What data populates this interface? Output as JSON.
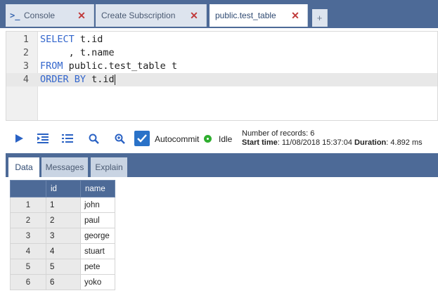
{
  "tabs": [
    {
      "label": "Console",
      "icon": "terminal-icon",
      "closable": true,
      "active": false
    },
    {
      "label": "Create Subscription",
      "closable": true,
      "active": false
    },
    {
      "label": "public.test_table",
      "closable": true,
      "active": true
    }
  ],
  "add_tab_label": "+",
  "editor": {
    "lines": [
      {
        "num": "1",
        "parts": [
          {
            "t": "SELECT",
            "kw": true
          },
          {
            "t": " t.id",
            "kw": false
          }
        ]
      },
      {
        "num": "2",
        "parts": [
          {
            "t": "     , t.name",
            "kw": false
          }
        ]
      },
      {
        "num": "3",
        "parts": [
          {
            "t": "FROM",
            "kw": true
          },
          {
            "t": " public.test_table t",
            "kw": false
          }
        ]
      },
      {
        "num": "4",
        "parts": [
          {
            "t": "ORDER BY",
            "kw": true
          },
          {
            "t": " t.id",
            "kw": false
          }
        ]
      }
    ],
    "current_line": 4
  },
  "toolbar": {
    "buttons": [
      "play-icon",
      "indent-icon",
      "list-icon",
      "search-icon",
      "zoom-in-icon"
    ],
    "autocommit_checked": true,
    "autocommit_label": "Autocommit",
    "status": "Idle",
    "status_color": "#2fae2f"
  },
  "records": {
    "count_line": "Number of records: 6",
    "start_label": "Start time",
    "start_value": ": 11/08/2018 15:37:04",
    "duration_label": "Duration",
    "duration_value": ": 4.892 ms"
  },
  "result_tabs": [
    {
      "label": "Data",
      "active": true
    },
    {
      "label": "Messages",
      "active": false
    },
    {
      "label": "Explain",
      "active": false
    }
  ],
  "table": {
    "headers": [
      "",
      "id",
      "name"
    ],
    "rows": [
      [
        "1",
        "1",
        "john"
      ],
      [
        "2",
        "2",
        "paul"
      ],
      [
        "3",
        "3",
        "george"
      ],
      [
        "4",
        "4",
        "stuart"
      ],
      [
        "5",
        "5",
        "pete"
      ],
      [
        "6",
        "6",
        "yoko"
      ]
    ]
  },
  "colors": {
    "accent": "#4d6a97",
    "close": "#c03a3a",
    "keyword": "#3366cc"
  }
}
